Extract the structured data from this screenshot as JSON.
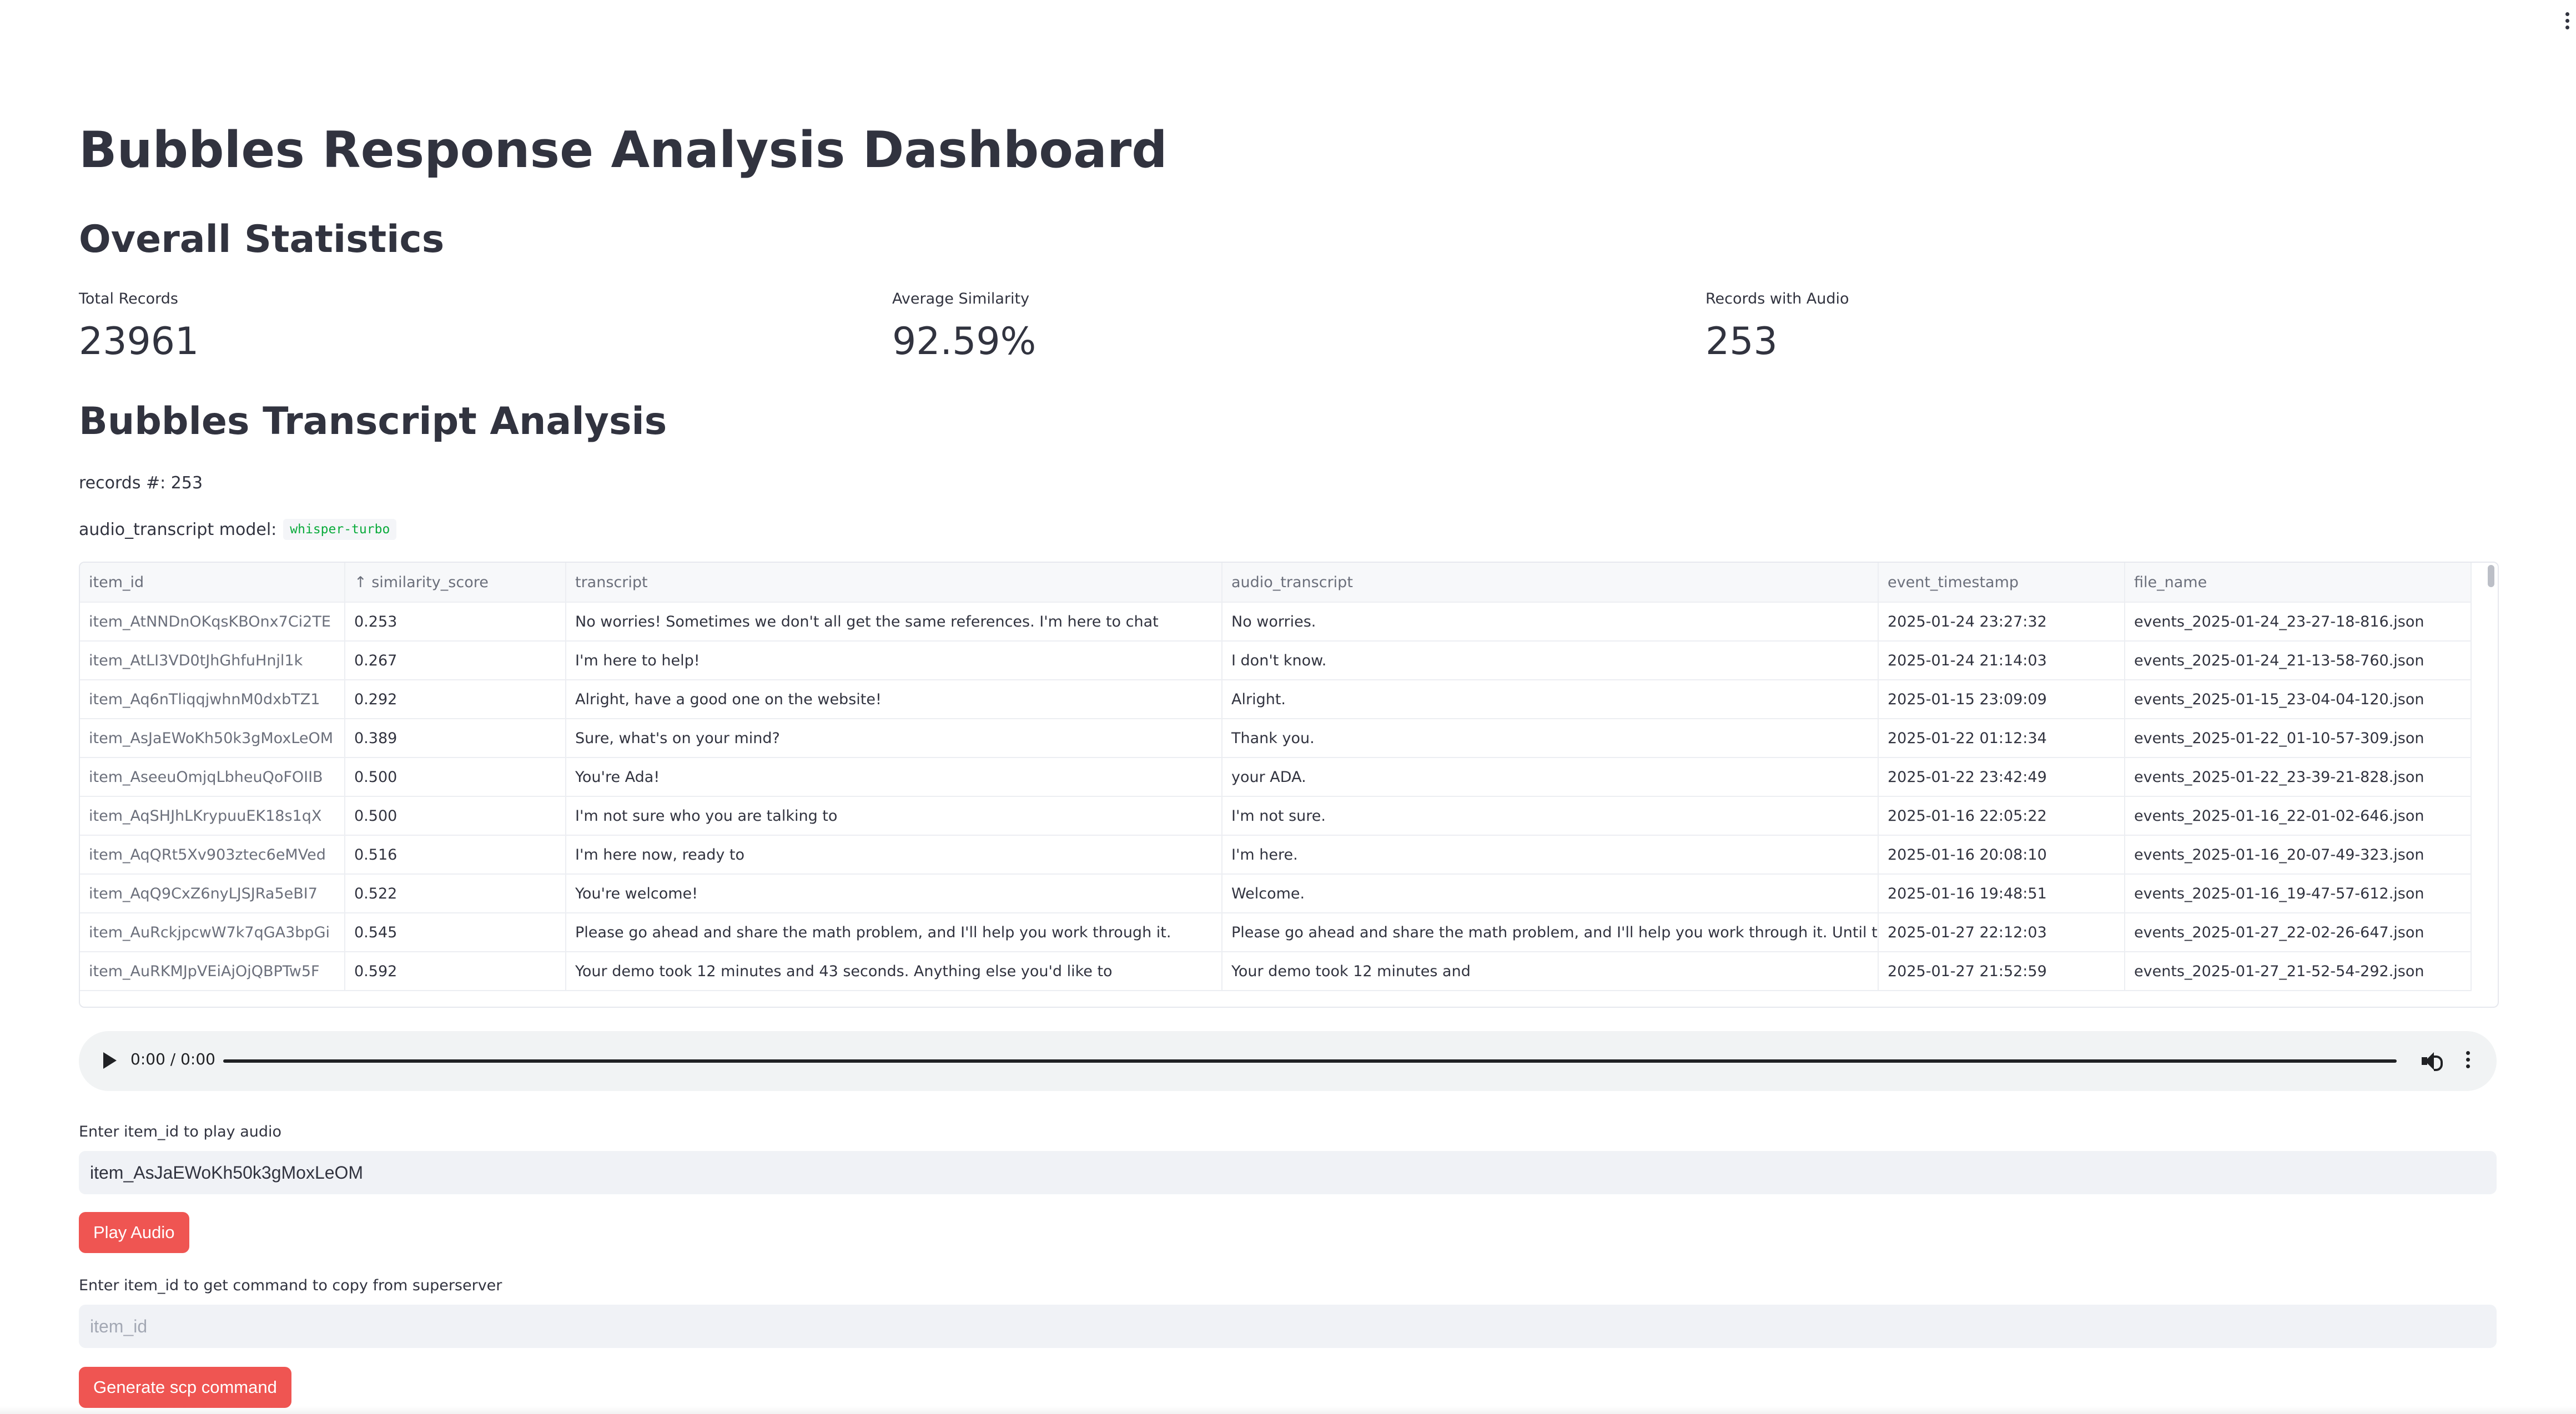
{
  "header": {
    "title": "Bubbles Response Analysis Dashboard"
  },
  "stats": {
    "heading": "Overall Statistics",
    "metrics": [
      {
        "label": "Total Records",
        "value": "23961"
      },
      {
        "label": "Average Similarity",
        "value": "92.59%"
      },
      {
        "label": "Records with Audio",
        "value": "253"
      }
    ]
  },
  "transcript": {
    "heading": "Bubbles Transcript Analysis",
    "records_text": "records #: 253",
    "model_label": "audio_transcript model:",
    "model_value": "whisper-turbo"
  },
  "table": {
    "columns": [
      "item_id",
      "↑ similarity_score",
      "transcript",
      "audio_transcript",
      "event_timestamp",
      "file_name"
    ],
    "sort": {
      "column": "similarity_score",
      "direction": "ascending"
    },
    "rows": [
      {
        "item_id": "item_AtNNDnOKqsKBOnx7Ci2TE",
        "similarity_score": "0.253",
        "transcript": "No worries! Sometimes we don't all get the same references. I'm here to chat",
        "audio_transcript": "No worries.",
        "event_timestamp": "2025-01-24 23:27:32",
        "file_name": "events_2025-01-24_23-27-18-816.json"
      },
      {
        "item_id": "item_AtLI3VD0tJhGhfuHnjl1k",
        "similarity_score": "0.267",
        "transcript": "I'm here to help!",
        "audio_transcript": "I don't know.",
        "event_timestamp": "2025-01-24 21:14:03",
        "file_name": "events_2025-01-24_21-13-58-760.json"
      },
      {
        "item_id": "item_Aq6nTliqqjwhnM0dxbTZ1",
        "similarity_score": "0.292",
        "transcript": "Alright, have a good one on the website!",
        "audio_transcript": "Alright.",
        "event_timestamp": "2025-01-15 23:09:09",
        "file_name": "events_2025-01-15_23-04-04-120.json"
      },
      {
        "item_id": "item_AsJaEWoKh50k3gMoxLeOM",
        "similarity_score": "0.389",
        "transcript": "Sure, what's on your mind?",
        "audio_transcript": "Thank you.",
        "event_timestamp": "2025-01-22 01:12:34",
        "file_name": "events_2025-01-22_01-10-57-309.json"
      },
      {
        "item_id": "item_AseeuOmjqLbheuQoFOIIB",
        "similarity_score": "0.500",
        "transcript": "You're Ada!",
        "audio_transcript": "your ADA.",
        "event_timestamp": "2025-01-22 23:42:49",
        "file_name": "events_2025-01-22_23-39-21-828.json"
      },
      {
        "item_id": "item_AqSHJhLKrypuuEK18s1qX",
        "similarity_score": "0.500",
        "transcript": "I'm not sure who you are talking to",
        "audio_transcript": "I'm not sure.",
        "event_timestamp": "2025-01-16 22:05:22",
        "file_name": "events_2025-01-16_22-01-02-646.json"
      },
      {
        "item_id": "item_AqQRt5Xv903ztec6eMVed",
        "similarity_score": "0.516",
        "transcript": "I'm here now, ready to",
        "audio_transcript": "I'm here.",
        "event_timestamp": "2025-01-16 20:08:10",
        "file_name": "events_2025-01-16_20-07-49-323.json"
      },
      {
        "item_id": "item_AqQ9CxZ6nyLJSJRa5eBI7",
        "similarity_score": "0.522",
        "transcript": "You're welcome!",
        "audio_transcript": "Welcome.",
        "event_timestamp": "2025-01-16 19:48:51",
        "file_name": "events_2025-01-16_19-47-57-612.json"
      },
      {
        "item_id": "item_AuRckjpcwW7k7qGA3bpGi",
        "similarity_score": "0.545",
        "transcript": "Please go ahead and share the math problem, and I'll help you work through it.",
        "audio_transcript": "Please go ahead and share the math problem, and I'll help you work through it. Until then, why don't",
        "event_timestamp": "2025-01-27 22:12:03",
        "file_name": "events_2025-01-27_22-02-26-647.json"
      },
      {
        "item_id": "item_AuRKMJpVEiAjOjQBPTw5F",
        "similarity_score": "0.592",
        "transcript": "Your demo took 12 minutes and 43 seconds. Anything else you'd like to",
        "audio_transcript": "Your demo took 12 minutes and",
        "event_timestamp": "2025-01-27 21:52:59",
        "file_name": "events_2025-01-27_21-52-54-292.json"
      }
    ]
  },
  "audio_player": {
    "time": "0:00 / 0:00",
    "progress": 0
  },
  "play_form": {
    "label": "Enter item_id to play audio",
    "value": "item_AsJaEWoKh50k3gMoxLeOM",
    "button": "Play Audio"
  },
  "scp_form": {
    "label": "Enter item_id to get command to copy from superserver",
    "placeholder": "item_id",
    "value": "",
    "button": "Generate scp command"
  }
}
